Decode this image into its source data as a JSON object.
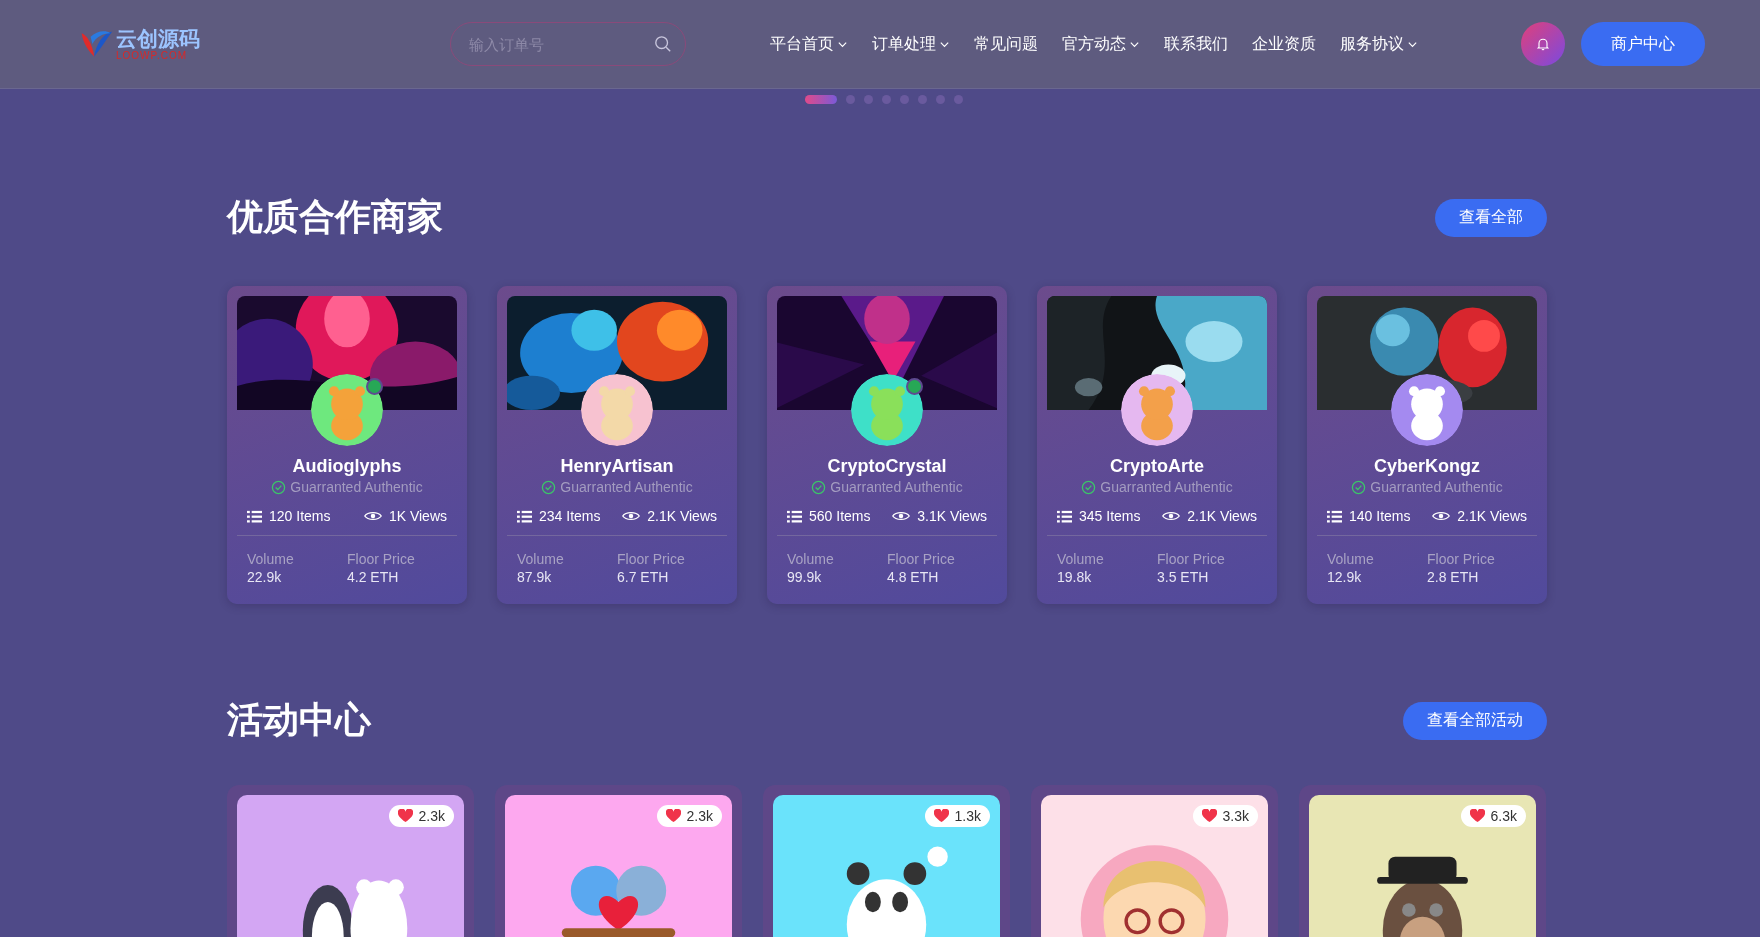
{
  "header": {
    "logo": {
      "title": "云创源码",
      "subtitle": "LOOWP.COM"
    },
    "search": {
      "placeholder": "输入订单号"
    },
    "nav": [
      {
        "label": "平台首页",
        "has_menu": true
      },
      {
        "label": "订单处理",
        "has_menu": true
      },
      {
        "label": "常见问题",
        "has_menu": false
      },
      {
        "label": "官方动态",
        "has_menu": true
      },
      {
        "label": "联系我们",
        "has_menu": false
      },
      {
        "label": "企业资质",
        "has_menu": false
      },
      {
        "label": "服务协议",
        "has_menu": true
      }
    ],
    "merchant_button": "商户中心"
  },
  "carousel_dots": [
    {
      "selected": true
    },
    {
      "selected": false
    },
    {
      "selected": false
    },
    {
      "selected": false
    },
    {
      "selected": false
    },
    {
      "selected": false
    },
    {
      "selected": false
    },
    {
      "selected": false
    }
  ],
  "merchants": {
    "title": "优质合作商家",
    "view_all": "查看全部",
    "cards": [
      {
        "name": "Audioglyphs",
        "badge": "Guarranted Authentic",
        "online": true,
        "items": "120 Items",
        "views": "1K Views",
        "volume_label": "Volume",
        "volume": "22.9k",
        "floor_label": "Floor Price",
        "floor": "4.2 ETH"
      },
      {
        "name": "HenryArtisan",
        "badge": "Guarranted Authentic",
        "online": false,
        "items": "234 Items",
        "views": "2.1K Views",
        "volume_label": "Volume",
        "volume": "87.9k",
        "floor_label": "Floor Price",
        "floor": "6.7 ETH"
      },
      {
        "name": "CryptoCrystal",
        "badge": "Guarranted Authentic",
        "online": true,
        "items": "560 Items",
        "views": "3.1K Views",
        "volume_label": "Volume",
        "volume": "99.9k",
        "floor_label": "Floor Price",
        "floor": "4.8 ETH"
      },
      {
        "name": "CryptoArte",
        "badge": "Guarranted Authentic",
        "online": false,
        "items": "345 Items",
        "views": "2.1K Views",
        "volume_label": "Volume",
        "volume": "19.8k",
        "floor_label": "Floor Price",
        "floor": "3.5 ETH"
      },
      {
        "name": "CyberKongz",
        "badge": "Guarranted Authentic",
        "online": false,
        "items": "140 Items",
        "views": "2.1K Views",
        "volume_label": "Volume",
        "volume": "12.9k",
        "floor_label": "Floor Price",
        "floor": "2.8 ETH"
      }
    ]
  },
  "activities": {
    "title": "活动中心",
    "view_all": "查看全部活动",
    "cards": [
      {
        "likes": "2.3k"
      },
      {
        "likes": "2.3k"
      },
      {
        "likes": "1.3k"
      },
      {
        "likes": "3.3k"
      },
      {
        "likes": "6.3k"
      }
    ]
  }
}
